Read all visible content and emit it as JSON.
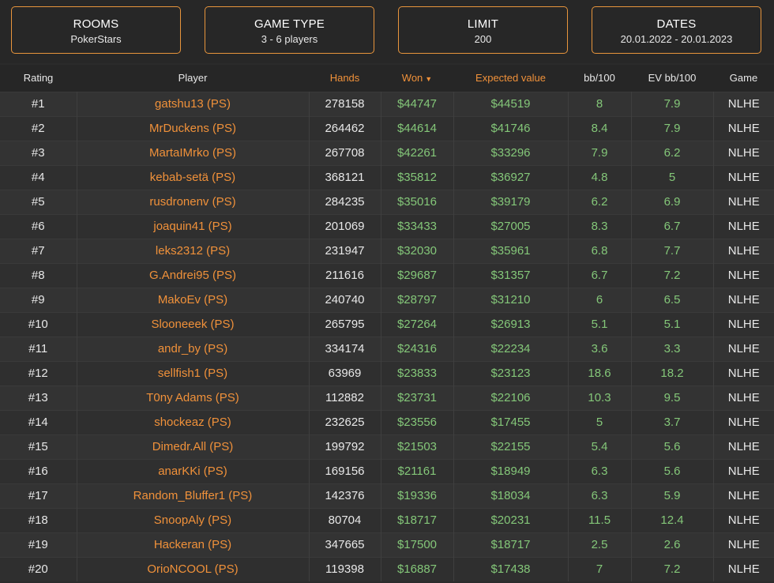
{
  "filters": [
    {
      "title": "ROOMS",
      "value": "PokerStars"
    },
    {
      "title": "GAME TYPE",
      "value": "3 - 6 players"
    },
    {
      "title": "LIMIT",
      "value": "200"
    },
    {
      "title": "DATES",
      "value": "20.01.2022 - 20.01.2023"
    }
  ],
  "table": {
    "headers": {
      "rating": "Rating",
      "player": "Player",
      "hands": "Hands",
      "won": "Won",
      "won_arrow": "▼",
      "ev": "Expected value",
      "bb100": "bb/100",
      "evbb100": "EV bb/100",
      "game": "Game"
    },
    "rows": [
      {
        "rank": "#1",
        "player": "gatshu13 (PS)",
        "hands": "278158",
        "won": "$44747",
        "ev": "$44519",
        "bb100": "8",
        "evbb100": "7.9",
        "game": "NLHE"
      },
      {
        "rank": "#2",
        "player": "MrDuckens (PS)",
        "hands": "264462",
        "won": "$44614",
        "ev": "$41746",
        "bb100": "8.4",
        "evbb100": "7.9",
        "game": "NLHE"
      },
      {
        "rank": "#3",
        "player": "MartaIMrko (PS)",
        "hands": "267708",
        "won": "$42261",
        "ev": "$33296",
        "bb100": "7.9",
        "evbb100": "6.2",
        "game": "NLHE"
      },
      {
        "rank": "#4",
        "player": "kebab-setä (PS)",
        "hands": "368121",
        "won": "$35812",
        "ev": "$36927",
        "bb100": "4.8",
        "evbb100": "5",
        "game": "NLHE"
      },
      {
        "rank": "#5",
        "player": "rusdronenv (PS)",
        "hands": "284235",
        "won": "$35016",
        "ev": "$39179",
        "bb100": "6.2",
        "evbb100": "6.9",
        "game": "NLHE"
      },
      {
        "rank": "#6",
        "player": "joaquin41 (PS)",
        "hands": "201069",
        "won": "$33433",
        "ev": "$27005",
        "bb100": "8.3",
        "evbb100": "6.7",
        "game": "NLHE"
      },
      {
        "rank": "#7",
        "player": "leks2312 (PS)",
        "hands": "231947",
        "won": "$32030",
        "ev": "$35961",
        "bb100": "6.8",
        "evbb100": "7.7",
        "game": "NLHE"
      },
      {
        "rank": "#8",
        "player": "G.Andrei95 (PS)",
        "hands": "211616",
        "won": "$29687",
        "ev": "$31357",
        "bb100": "6.7",
        "evbb100": "7.2",
        "game": "NLHE"
      },
      {
        "rank": "#9",
        "player": "MakoEv (PS)",
        "hands": "240740",
        "won": "$28797",
        "ev": "$31210",
        "bb100": "6",
        "evbb100": "6.5",
        "game": "NLHE"
      },
      {
        "rank": "#10",
        "player": "Slooneeek (PS)",
        "hands": "265795",
        "won": "$27264",
        "ev": "$26913",
        "bb100": "5.1",
        "evbb100": "5.1",
        "game": "NLHE"
      },
      {
        "rank": "#11",
        "player": "andr_by (PS)",
        "hands": "334174",
        "won": "$24316",
        "ev": "$22234",
        "bb100": "3.6",
        "evbb100": "3.3",
        "game": "NLHE"
      },
      {
        "rank": "#12",
        "player": "sellfish1 (PS)",
        "hands": "63969",
        "won": "$23833",
        "ev": "$23123",
        "bb100": "18.6",
        "evbb100": "18.2",
        "game": "NLHE"
      },
      {
        "rank": "#13",
        "player": "T0ny Adams (PS)",
        "hands": "112882",
        "won": "$23731",
        "ev": "$22106",
        "bb100": "10.3",
        "evbb100": "9.5",
        "game": "NLHE"
      },
      {
        "rank": "#14",
        "player": "shockeaz (PS)",
        "hands": "232625",
        "won": "$23556",
        "ev": "$17455",
        "bb100": "5",
        "evbb100": "3.7",
        "game": "NLHE"
      },
      {
        "rank": "#15",
        "player": "Dimedr.All (PS)",
        "hands": "199792",
        "won": "$21503",
        "ev": "$22155",
        "bb100": "5.4",
        "evbb100": "5.6",
        "game": "NLHE"
      },
      {
        "rank": "#16",
        "player": "anarKKi (PS)",
        "hands": "169156",
        "won": "$21161",
        "ev": "$18949",
        "bb100": "6.3",
        "evbb100": "5.6",
        "game": "NLHE"
      },
      {
        "rank": "#17",
        "player": "Random_Bluffer1 (PS)",
        "hands": "142376",
        "won": "$19336",
        "ev": "$18034",
        "bb100": "6.3",
        "evbb100": "5.9",
        "game": "NLHE"
      },
      {
        "rank": "#18",
        "player": "SnoopAly (PS)",
        "hands": "80704",
        "won": "$18717",
        "ev": "$20231",
        "bb100": "11.5",
        "evbb100": "12.4",
        "game": "NLHE"
      },
      {
        "rank": "#19",
        "player": "Hackeran (PS)",
        "hands": "347665",
        "won": "$17500",
        "ev": "$18717",
        "bb100": "2.5",
        "evbb100": "2.6",
        "game": "NLHE"
      },
      {
        "rank": "#20",
        "player": "OrioNCOOL (PS)",
        "hands": "119398",
        "won": "$16887",
        "ev": "$17438",
        "bb100": "7",
        "evbb100": "7.2",
        "game": "NLHE"
      }
    ]
  },
  "colors": {
    "accent": "#f0913a",
    "positive": "#84c779",
    "background": "#2b2b2b",
    "filter_border": "#e8953c"
  }
}
